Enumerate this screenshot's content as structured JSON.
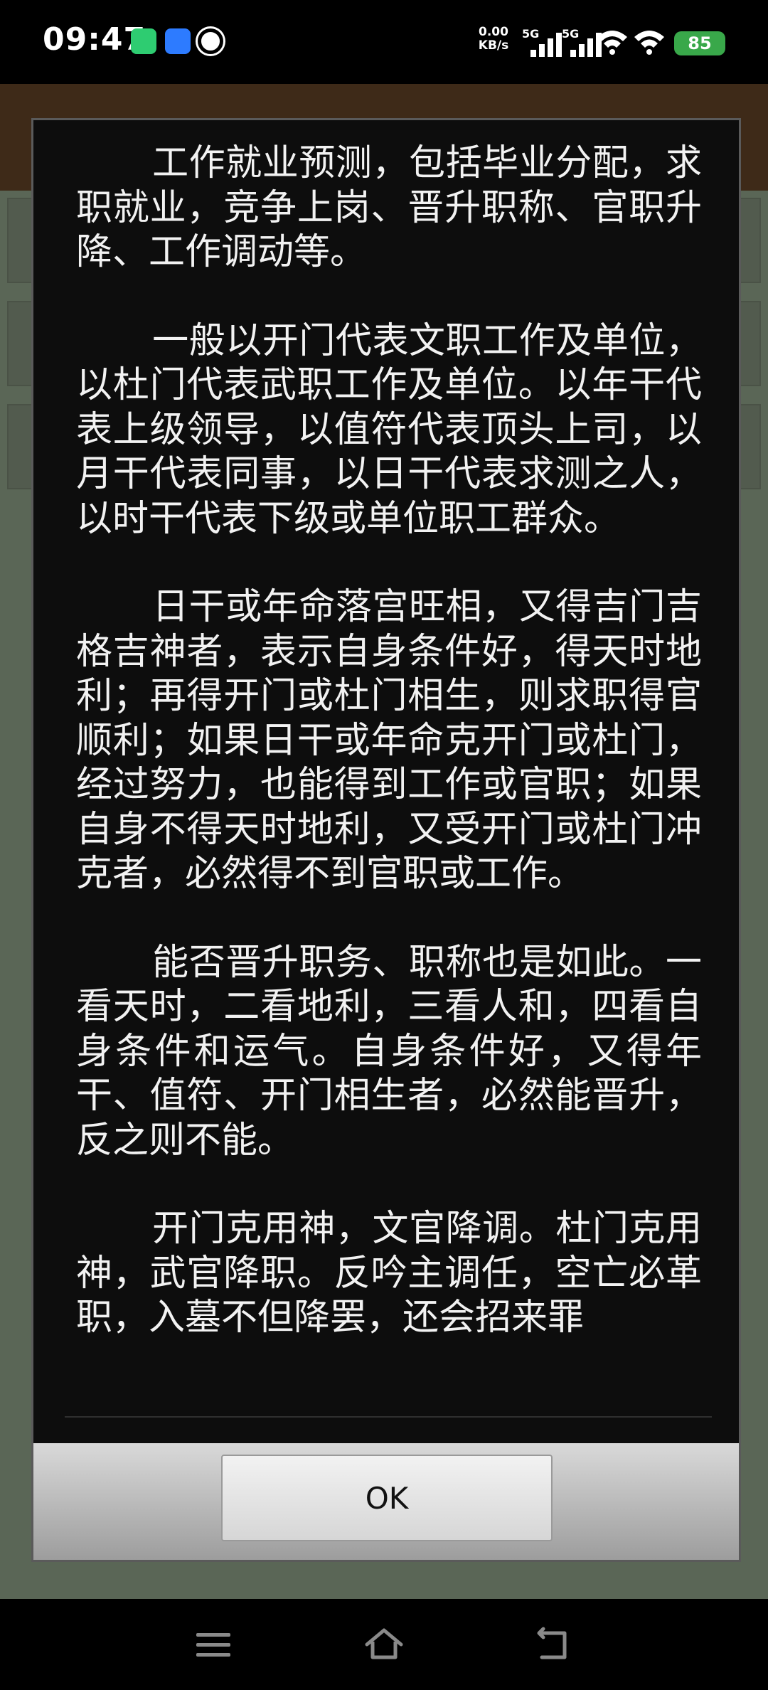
{
  "status_bar": {
    "time": "09:47",
    "network_speed_value": "0.00",
    "network_speed_unit": "KB/s",
    "signal_1_label": "5G",
    "signal_2_label": "5G",
    "battery_level": "85",
    "app_icons": [
      "phone-call-icon",
      "blue-app-icon",
      "circle-app-icon"
    ]
  },
  "dialog": {
    "paragraphs": [
      "工作就业预测，包括毕业分配，求职就业，竞争上岗、晋升职称、官职升降、工作调动等。",
      "一般以开门代表文职工作及单位，以杜门代表武职工作及单位。以年干代表上级领导，以值符代表顶头上司，以月干代表同事，以日干代表求测之人，以时干代表下级或单位职工群众。",
      "日干或年命落宫旺相，又得吉门吉格吉神者，表示自身条件好，得天时地利；再得开门或杜门相生，则求职得官顺利；如果日干或年命克开门或杜门，经过努力，也能得到工作或官职；如果自身不得天时地利，又受开门或杜门冲克者，必然得不到官职或工作。",
      "能否晋升职务、职称也是如此。一看天时，二看地利，三看人和，四看自身条件和运气。自身条件好，又得年干、值符、开门相生者，必然能晋升，反之则不能。",
      "开门克用神，文官降调。杜门克用神，武官降职。反吟主调任，空亡必革职，入墓不但降罢，还会招来罪"
    ],
    "ok_label": "OK"
  },
  "colors": {
    "dialog_bg": "#0d0d0d",
    "text": "#f2f2f2",
    "battery": "#39a84a"
  }
}
